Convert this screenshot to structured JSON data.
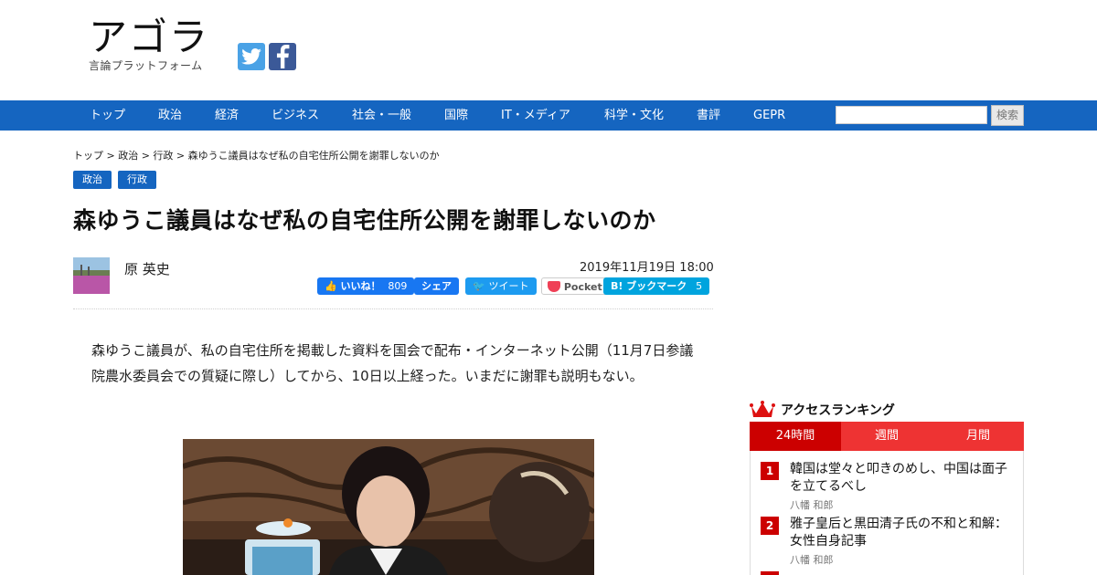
{
  "header": {
    "logo_main": "アゴラ",
    "logo_sub": "言論プラットフォーム",
    "social": [
      "twitter-icon",
      "facebook-icon"
    ]
  },
  "nav": {
    "items": [
      "トップ",
      "政治",
      "経済",
      "ビジネス",
      "社会・一般",
      "国際",
      "IT・メディア",
      "科学・文化",
      "書評",
      "GEPR"
    ],
    "search_placeholder": "",
    "search_button": "検索"
  },
  "breadcrumb": "トップ > 政治 > 行政 > 森ゆうこ議員はなぜ私の自宅住所公開を謝罪しないのか",
  "tags": [
    "政治",
    "行政"
  ],
  "article": {
    "title": "森ゆうこ議員はなぜ私の自宅住所公開を謝罪しないのか",
    "author": "原 英史",
    "date": "2019年11月19日 18:00",
    "body": "森ゆうこ議員が、私の自宅住所を掲載した資料を国会で配布・インターネット公開（11月7日参議院農水委員会での質疑に際し）してから、10日以上経った。いまだに謝罪も説明もない。"
  },
  "share": {
    "like_label": "いいね！",
    "like_count": "809",
    "fb_share": "シェア",
    "tweet": "ツイート",
    "pocket": "Pocket",
    "hatena": "B! ブックマーク",
    "hatena_count": "5"
  },
  "ranking": {
    "title": "アクセスランキング",
    "tabs": [
      "24時間",
      "週間",
      "月間"
    ],
    "items": [
      {
        "rank": "1",
        "title": "韓国は堂々と叩きのめし、中国は面子を立てるべし",
        "author": "八幡 和郎"
      },
      {
        "rank": "2",
        "title": "雅子皇后と黒田清子氏の不和と和解：女性自身記事",
        "author": "八幡 和郎"
      }
    ]
  },
  "colors": {
    "nav_blue": "#1565c0",
    "rank_red": "#cc0000",
    "twitter": "#4aa2e6",
    "facebook": "#3b5998"
  }
}
